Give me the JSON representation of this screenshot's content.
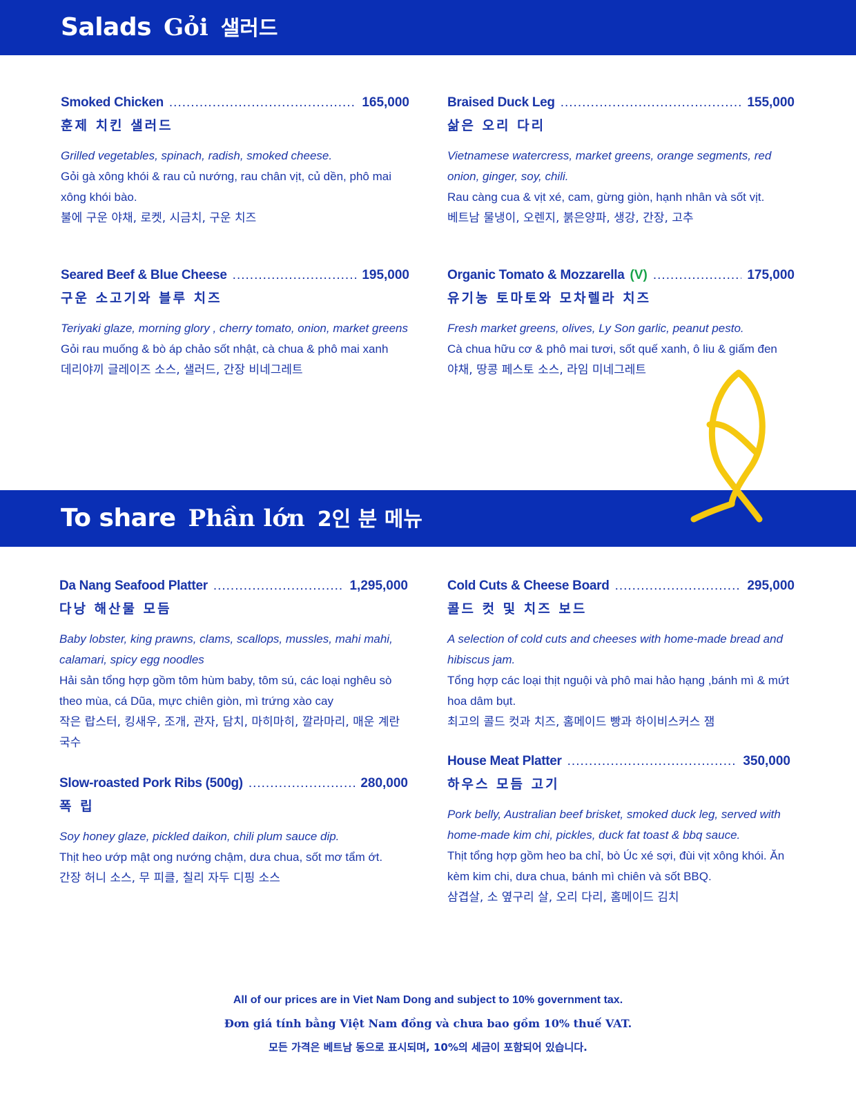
{
  "sections": {
    "salads": {
      "en": "Salads",
      "vi": "Gỏi",
      "ko": "샐러드"
    },
    "share": {
      "en": "To share",
      "vi": "Phần lớn",
      "ko": "2인 분 메뉴"
    }
  },
  "items": {
    "smoked_chicken": {
      "name": "Smoked Chicken",
      "price": "165,000",
      "ko_name": "훈제 치킨 샐러드",
      "desc": [
        "Grilled vegetables, spinach, radish, smoked cheese.",
        "Gỏi gà xông khói & rau củ nướng, rau chân vịt, củ dền, phô mai xông khói bào.",
        "불에 구운 야채, 로켓, 시금치, 구운 치즈"
      ]
    },
    "braised_duck": {
      "name": "Braised Duck Leg",
      "price": "155,000",
      "ko_name": "삶은 오리 다리",
      "desc": [
        "Vietnamese watercress, market greens, orange segments, red onion, ginger, soy, chili.",
        "Rau càng cua & vịt xé, cam, gừng giòn, hạnh nhân và sốt vịt.",
        "베트남 물냉이, 오렌지, 붉은양파, 생강, 간장, 고추"
      ]
    },
    "seared_beef": {
      "name": "Seared Beef & Blue Cheese",
      "price": "195,000",
      "ko_name": "구운 소고기와 블루 치즈",
      "desc": [
        "Teriyaki glaze, morning glory , cherry tomato, onion, market greens",
        "Gỏi rau muống & bò áp chảo sốt nhật, cà chua & phô mai xanh",
        "데리야끼 글레이즈 소스, 샐러드, 간장 비네그레트"
      ]
    },
    "organic_tomato": {
      "name": "Organic Tomato & Mozzarella",
      "veg": "(V)",
      "price": "175,000",
      "ko_name": "유기농 토마토와 모차렐라 치즈",
      "desc": [
        "Fresh market greens, olives, Ly Son garlic, peanut pesto.",
        "Cà chua hữu cơ & phô mai tươi, sốt quế xanh, ô liu & giấm đen",
        "야채, 땅콩 페스토 소스, 라임 미네그레트"
      ]
    },
    "seafood_platter": {
      "name": "Da Nang Seafood Platter",
      "price": "1,295,000",
      "ko_name": "다낭 해산물 모듬",
      "desc": [
        "Baby lobster, king prawns, clams, scallops, mussles, mahi mahi, calamari, spicy egg noodles",
        "Hải sản tổng hợp gồm tôm hùm baby, tôm sú, các loại nghêu sò theo mùa, cá Dũa, mực chiên giòn, mì trứng xào cay",
        "작은 랍스터, 킹새우, 조개, 관자, 담치, 마히마히, 깔라마리, 매운 계란 국수"
      ]
    },
    "cold_cuts": {
      "name": "Cold Cuts & Cheese Board",
      "price": "295,000",
      "ko_name": "콜드 컷 및 치즈 보드",
      "desc": [
        "A selection of cold cuts and cheeses with home-made bread and hibiscus jam.",
        "Tổng hợp các loại thịt nguội và phô mai hảo hạng ,bánh mì & mứt hoa dâm bụt.",
        "최고의 콜드 컷과 치즈, 홈메이드 빵과 하이비스커스 잼"
      ]
    },
    "pork_ribs": {
      "name": "Slow-roasted Pork Ribs (500g)",
      "price": "280,000",
      "ko_name": "폭 립",
      "desc": [
        "Soy honey glaze, pickled daikon, chili plum sauce dip.",
        "Thịt heo ướp mật ong nướng chậm, dưa chua, sốt mơ tẩm ớt.",
        "간장 허니 소스, 무 피클, 칠리 자두 디핑 소스"
      ]
    },
    "meat_platter": {
      "name": "House Meat Platter",
      "price": "350,000",
      "ko_name": "하우스 모듬 고기",
      "desc": [
        "Pork belly, Australian beef brisket, smoked duck leg, served with home-made kim chi, pickles, duck fat toast & bbq sauce.",
        "Thịt tổng hợp gồm heo ba chỉ, bò Úc xé sợi, đùi vịt xông khói. Ăn kèm kim chi, dưa chua, bánh mì chiên và sốt BBQ.",
        "삼겹살, 소 옆구리 살, 오리 다리, 홈메이드 김치"
      ]
    }
  },
  "footer": {
    "en": "All of our prices are in Viet Nam Dong and subject to 10% government tax.",
    "vi": "Đơn giá tính bằng Việt Nam đồng và chưa bao gồm 10% thuế VAT.",
    "ko": "모든 가격은 베트남 동으로 표시되며, 10%의 세금이 포함되어 있습니다."
  },
  "colors": {
    "band": "#0a2fb5",
    "text": "#1a35a8",
    "veg": "#19a34a",
    "fish": "#f5c80f"
  },
  "icons": {
    "logo": "fish-icon"
  }
}
